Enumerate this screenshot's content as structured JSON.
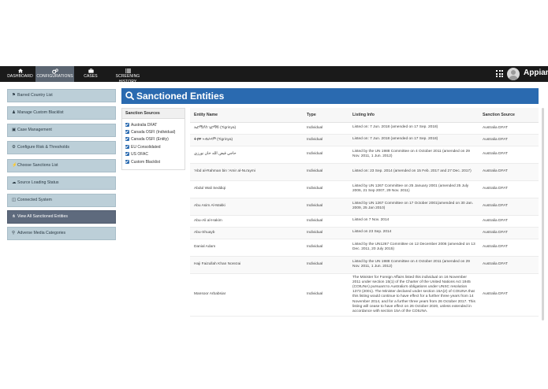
{
  "nav": {
    "items": [
      {
        "label": "DASHBOARD",
        "icon": "home-icon"
      },
      {
        "label": "CONFIGURATIONS",
        "icon": "cogs-icon"
      },
      {
        "label": "CASES",
        "icon": "briefcase-icon"
      },
      {
        "label": "SCREENING HISTORY",
        "icon": "list-icon"
      }
    ],
    "active": "CONFIGURATIONS",
    "brand": "Appian"
  },
  "sidebar": {
    "items": [
      {
        "label": "Barred Country List",
        "icon": "flag-icon"
      },
      {
        "label": "Manage Custom Blacklist",
        "icon": "users-icon"
      },
      {
        "label": "Case Management",
        "icon": "briefcase-icon"
      },
      {
        "label": "Configure Risk & Thresholds",
        "icon": "cogs-icon"
      },
      {
        "label": "Choose Sanctions List",
        "icon": "bolt-icon"
      },
      {
        "label": "Source Loading Status",
        "icon": "cloud-download-icon"
      },
      {
        "label": "Connected System",
        "icon": "database-icon"
      },
      {
        "label": "View All Sanctioned Entities",
        "icon": "code-fork-icon"
      },
      {
        "label": "Adverse Media Categories",
        "icon": "search-icon"
      }
    ],
    "active_index": 7
  },
  "page": {
    "title": "Sanctioned Entities"
  },
  "sources": {
    "title": "Sanction Sources",
    "items": [
      "Australia DFAT",
      "Canada OSFI (Individual)",
      "Canada OSFI (Entity)",
      "EU Consolidated",
      "US OFAC",
      "Custom Blacklist"
    ]
  },
  "table": {
    "columns": [
      "Entity Name",
      "Type",
      "Listing Info",
      "Sanction Source"
    ],
    "rows": [
      {
        "name": "ኤርሚያስ ጊርማይ (Tigrinya)",
        "type": "Individual",
        "info": "Listed on: 7 Jun. 2018 (amended on 17 Sep. 2018)",
        "source": "Australia DFAT"
      },
      {
        "name": "ፋቲዋ ኣብራሃም (Tigrinya)",
        "type": "Individual",
        "info": "Listed on: 7 Jun. 2018 (amended on 17 Sep. 2018)",
        "source": "Australia DFAT"
      },
      {
        "name": "حاجي فيض الله خان نورزي",
        "type": "Individual",
        "info": "Listed by the UN 1988 Committee on 4 October 2011 (amended on 29 Nov. 2011, 1 Jun. 2012)",
        "source": "Australia DFAT"
      },
      {
        "name": "'Abd al-Rahman bin 'Amir al-Nu'aymi",
        "type": "Individual",
        "info": "Listed on: 23 Sep. 2014 (amended on 15 Feb. 2017 and 27 Dec. 2017)",
        "source": "Australia DFAT"
      },
      {
        "name": "Abdul Wali Seddiqi",
        "type": "Individual",
        "info": "Listed by UN 1267 Committee on 25 January 2001 (amended 25 July 2006, 21 Sep 2007, 29 Nov. 2011)",
        "source": "Australia DFAT"
      },
      {
        "name": "Abu Asim Al-Makki",
        "type": "Individual",
        "info": "Listed by UN 1267 Committee on 17 October 2001(amended on 30 Jan. 2009, 25 Jan 2010)",
        "source": "Australia DFAT"
      },
      {
        "name": "Abu-Ali al-Hakim",
        "type": "Individual",
        "info": "Listed on 7 Nov. 2014",
        "source": "Australia DFAT"
      },
      {
        "name": "Abu-Shuayb",
        "type": "Individual",
        "info": "Listed on 23 Sep. 2014",
        "source": "Australia DFAT"
      },
      {
        "name": "Danial Adam",
        "type": "Individual",
        "info": "Listed by the UN1267 Committee on 12 December 2006 (amended on 13 Dec. 2011, 20 July 2015)",
        "source": "Australia DFAT"
      },
      {
        "name": "Haji Faizullah Khan Norezai",
        "type": "Individual",
        "info": "Listed by the UN 1988 Committee on 4 October 2011 (amended on 29 Nov. 2011, 1 Jun. 2012)",
        "source": "Australia DFAT"
      },
      {
        "name": "Mansoor Arbabsiar",
        "type": "Individual",
        "info": "The Minister for Foreign Affairs listed this individual on 16 November 2011 under section 15(1) of the Charter of the United Nations Act 1945 (COtUNA) pursuant to Australia's obligations under UNSC resolution 1373 (2001). The Minister declared under section 15A(2) of COtUNA that this listing would continue to have effect for a further three years from 14 November 2014, and for a further three years from 26 October 2017. This listing will cease to have effect on 26 October 2020, unless extended in accordance with section 15A of the COtUNA.",
        "source": "Australia DFAT"
      }
    ]
  }
}
